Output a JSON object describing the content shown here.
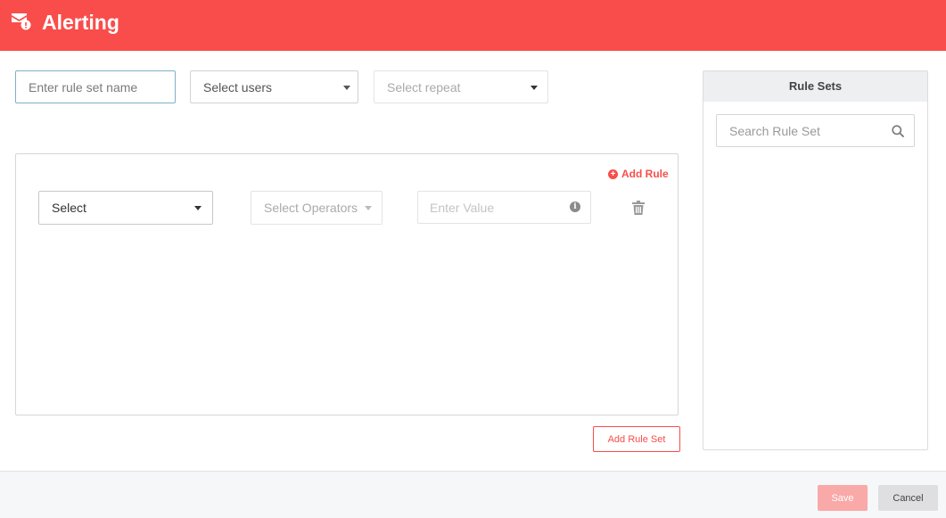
{
  "header": {
    "title": "Alerting",
    "icon": "alert-mail-icon",
    "background_color": "#f94d4b"
  },
  "form": {
    "rule_set_name_placeholder": "Enter rule set name",
    "select_users_label": "Select users",
    "select_repeat_label": "Select repeat"
  },
  "rules": {
    "add_rule_label": "Add Rule",
    "add_rule_icon": "plus-circle-icon",
    "items": [
      {
        "field_label": "Select",
        "operator_label": "Select Operators",
        "value_placeholder": "Enter Value",
        "info_icon": "info-icon",
        "delete_icon": "trash-icon"
      }
    ],
    "add_rule_set_label": "Add Rule Set"
  },
  "rule_sets_panel": {
    "title": "Rule Sets",
    "search_placeholder": "Search Rule Set",
    "search_icon": "search-icon"
  },
  "footer": {
    "save_label": "Save",
    "cancel_label": "Cancel"
  }
}
